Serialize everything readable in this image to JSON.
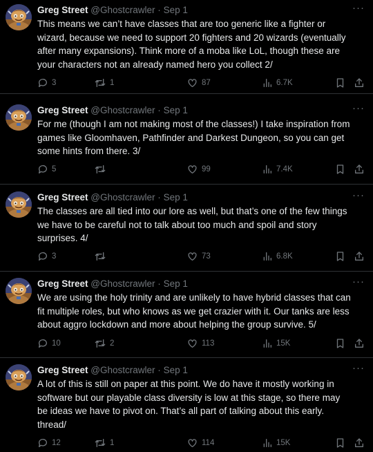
{
  "colors": {
    "background": "#000000",
    "text": "#e7e9ea",
    "muted": "#71767b",
    "divider": "#2f3336"
  },
  "icons": {
    "reply": "speech-bubble-icon",
    "retweet": "retweet-arrows-icon",
    "like": "heart-icon",
    "views": "bar-chart-icon",
    "bookmark": "bookmark-icon",
    "share": "share-upload-icon",
    "more": "more-dots-icon"
  },
  "tweets": [
    {
      "author": "Greg Street",
      "handle": "@Ghostcrawler",
      "dot": "·",
      "date": "Sep 1",
      "more": "···",
      "text": "This means we can’t have classes that are too generic like a fighter or\nwizard, because we need to support 20 fighters and 20 wizards (eventually\nafter many expansions). Think more of a moba like LoL, though these are\nyour characters not an already named hero you collect 2/",
      "replies": "3",
      "retweets": "1",
      "likes": "87",
      "views": "6.7K"
    },
    {
      "author": "Greg Street",
      "handle": "@Ghostcrawler",
      "dot": "·",
      "date": "Sep 1",
      "more": "···",
      "text": "For me (though I am not making most of the classes!) I take inspiration from\ngames like Gloomhaven, Pathfinder and Darkest Dungeon, so you can get\nsome hints from there. 3/",
      "replies": "5",
      "retweets": "",
      "likes": "99",
      "views": "7.4K"
    },
    {
      "author": "Greg Street",
      "handle": "@Ghostcrawler",
      "dot": "·",
      "date": "Sep 1",
      "more": "···",
      "text": "The classes are all tied into our lore as well, but that’s one of the few things\nwe have to be careful not to talk about too much and spoil and story\nsurprises. 4/",
      "replies": "3",
      "retweets": "",
      "likes": "73",
      "views": "6.8K"
    },
    {
      "author": "Greg Street",
      "handle": "@Ghostcrawler",
      "dot": "·",
      "date": "Sep 1",
      "more": "···",
      "text": "We are using the holy trinity and are unlikely to have hybrid classes that can\nfit multiple roles, but who knows as we get crazier with it. Our tanks are less\nabout aggro lockdown and more about helping the group survive. 5/",
      "replies": "10",
      "retweets": "2",
      "likes": "113",
      "views": "15K"
    },
    {
      "author": "Greg Street",
      "handle": "@Ghostcrawler",
      "dot": "·",
      "date": "Sep 1",
      "more": "···",
      "text": "A lot of this is still on paper at this point. We do have it mostly working in\nsoftware but our playable class diversity is low at this stage, so there may\nbe ideas we have to pivot on. That’s all part of talking about this early.\nthread/",
      "replies": "12",
      "retweets": "1",
      "likes": "114",
      "views": "15K"
    }
  ]
}
